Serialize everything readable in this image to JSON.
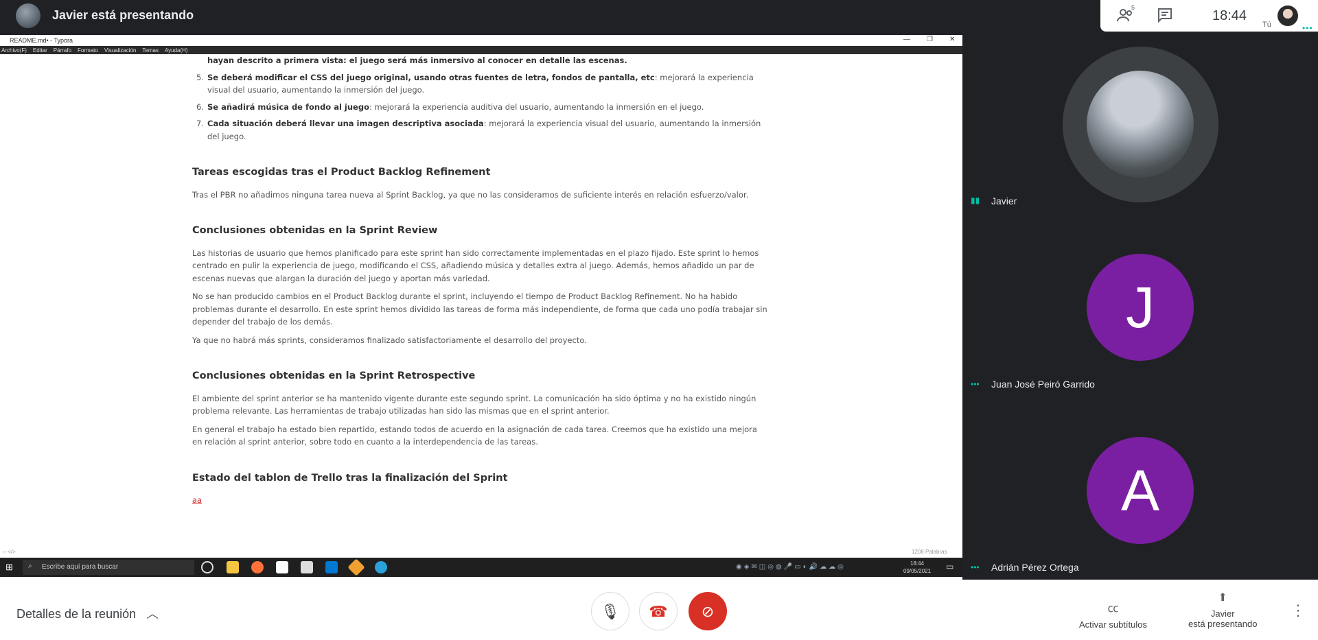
{
  "topbar": {
    "title": "Javier está presentando",
    "participants_count": "5",
    "time": "18:44",
    "self_label": "Tú"
  },
  "shared_screen": {
    "window_title": "README.md• - Typora",
    "menu": [
      "Archivo(F)",
      "Editar",
      "Párrafo",
      "Formato",
      "Visualización",
      "Temas",
      "Ayuda(H)"
    ],
    "doc": {
      "item4_tail": "hayan descrito a primera vista: el juego será más inmersivo al conocer en detalle las escenas.",
      "item5_bold": "Se deberá modificar el CSS del juego original, usando otras fuentes de letra, fondos de pantalla, etc",
      "item5_rest": ": mejorará la experiencia visual del usuario, aumentando la inmersión del juego.",
      "item6_bold": "Se añadirá música de fondo al juego",
      "item6_rest": ": mejorará la experiencia auditiva del usuario, aumentando la inmersión en el juego.",
      "item7_bold": "Cada situación deberá llevar una imagen descriptiva asociada",
      "item7_rest": ": mejorará la experiencia visual del usuario, aumentando la inmersión del juego.",
      "h_pbr": "Tareas escogidas tras el Product Backlog Refinement",
      "p_pbr": "Tras el PBR no añadimos ninguna tarea nueva al Sprint Backlog, ya que no las consideramos de suficiente interés en relación esfuerzo/valor.",
      "h_review": "Conclusiones obtenidas en la Sprint Review",
      "p_review1": "Las historias de usuario que hemos planificado para este sprint han sido correctamente implementadas en el plazo fijado. Este sprint lo hemos centrado en pulir la experiencia de juego, modificando el CSS, añadiendo música y detalles extra al juego. Además, hemos añadido un par de escenas nuevas que alargan la duración del juego y aportan más variedad.",
      "p_review2": "No se han producido cambios en el Product Backlog durante el sprint, incluyendo el tiempo de Product Backlog Refinement. No ha habido problemas durante el desarrollo. En este sprint hemos dividido las tareas de forma más independiente, de forma que cada uno podía trabajar sin depender del trabajo de los demás.",
      "p_review3": "Ya que no habrá más sprints, consideramos finalizado satisfactoriamente el desarrollo del proyecto.",
      "h_retro": "Conclusiones obtenidas en la Sprint Retrospective",
      "p_retro1": "El ambiente del sprint anterior se ha mantenido vigente durante este segundo sprint. La comunicación ha sido óptima y no ha existido ningún problema relevante. Las herramientas de trabajo utilizadas han sido las mismas que en el sprint anterior.",
      "p_retro2": "En general el trabajo ha estado bien repartido, estando todos de acuerdo en la asignación de cada tarea. Creemos que ha existido una mejora en relación al sprint anterior, sobre todo en cuanto a la interdependencia de las tareas.",
      "h_trello": "Estado del tablon de Trello tras la finalización del Sprint",
      "p_trello": "aa"
    },
    "word_count": "1208 Palabras",
    "taskbar": {
      "search_placeholder": "Escribe aquí para buscar",
      "clock_time": "18:44",
      "clock_date": "09/05/2021"
    }
  },
  "participants": [
    {
      "name": "Javier"
    },
    {
      "name": "Juan José Peiró Garrido",
      "initial": "J"
    },
    {
      "name": "Adrián Pérez Ortega",
      "initial": "A"
    }
  ],
  "bottombar": {
    "details_label": "Detalles de la reunión",
    "captions_label": "Activar subtítulos",
    "presenting_line1": "Javier",
    "presenting_line2": "está presentando"
  },
  "colors": {
    "accent_purple": "#7b1fa2",
    "hangup_red": "#d93025",
    "speaking_teal": "#00bfa5"
  }
}
